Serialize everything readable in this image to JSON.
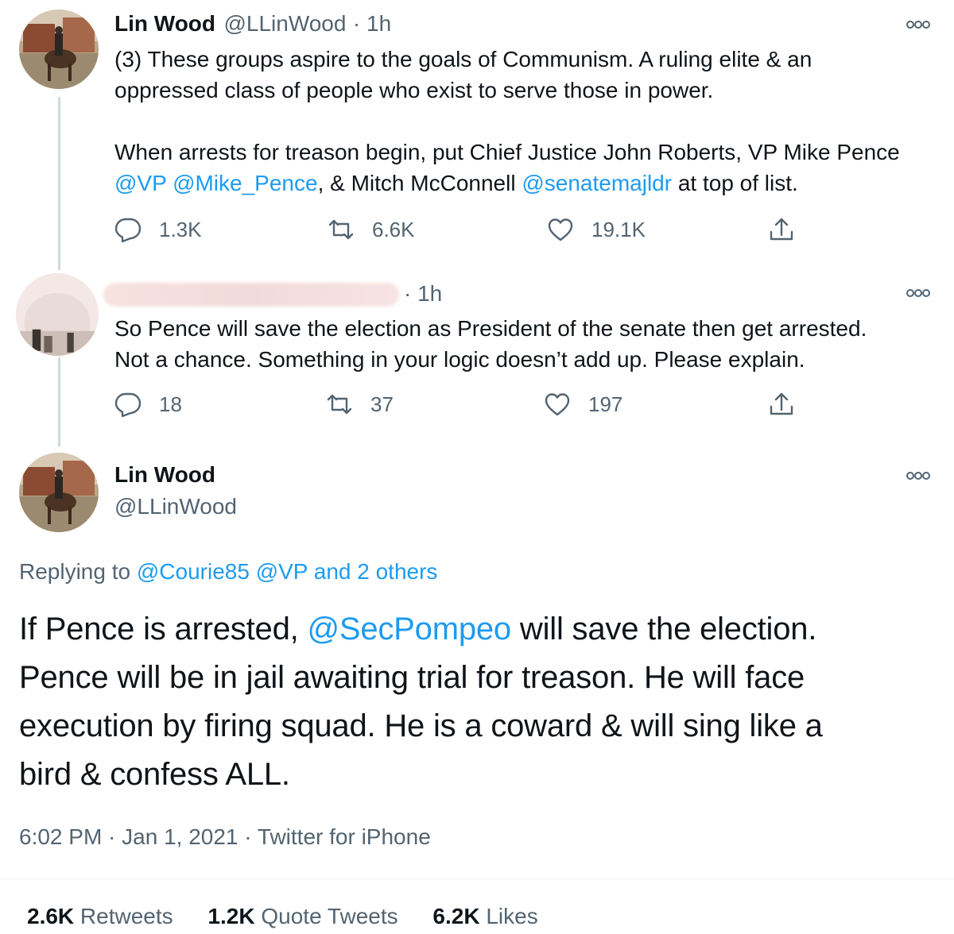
{
  "tweet1": {
    "name": "Lin Wood",
    "handle": "@LLinWood",
    "time": "· 1h",
    "line1": "(3) These groups aspire to the goals of Communism. A ruling elite & an",
    "line2": "oppressed class of people who exist to serve those in power.",
    "line3": "When arrests for treason begin, put Chief Justice John Roberts, VP Mike Pence",
    "mention_vp": "@VP",
    "mention_pence": "@Mike_Pence",
    "mid_text": ", & Mitch McConnell ",
    "mention_senate": "@senatemajldr",
    "end_text": " at top of list.",
    "replies": "1.3K",
    "retweets": "6.6K",
    "likes": "19.1K"
  },
  "tweet2": {
    "time": "· 1h",
    "line1": "So Pence will save the election as President of the senate then get arrested.",
    "line2": "Not a chance. Something in your logic doesn’t add up. Please explain.",
    "replies": "18",
    "retweets": "37",
    "likes": "197"
  },
  "main_tweet": {
    "name": "Lin Wood",
    "handle": "@LLinWood",
    "replying_prefix": "Replying to ",
    "replying_mentions": "@Courie85 @VP and 2 others",
    "text_start": "If Pence is arrested, ",
    "mention": "@SecPompeo",
    "text_line1_end": " will save the election.",
    "line2": "Pence will be in jail awaiting trial for treason. He will face",
    "line3": "execution by firing squad. He is a coward & will sing like a",
    "line4": "bird & confess ALL.",
    "timestamp": "6:02 PM · Jan 1, 2021 · ",
    "source": "Twitter for iPhone",
    "retweets_count": "2.6K",
    "retweets_label": " Retweets",
    "quotes_count": "1.2K",
    "quotes_label": " Quote Tweets",
    "likes_count": "6.2K",
    "likes_label": " Likes"
  },
  "colors": {
    "link": "#1d9bf0",
    "secondary": "#536471",
    "text": "#0f1419",
    "thread_line": "#cfd9de"
  },
  "icons": [
    "more-icon",
    "reply-icon",
    "retweet-icon",
    "like-icon",
    "share-icon"
  ]
}
